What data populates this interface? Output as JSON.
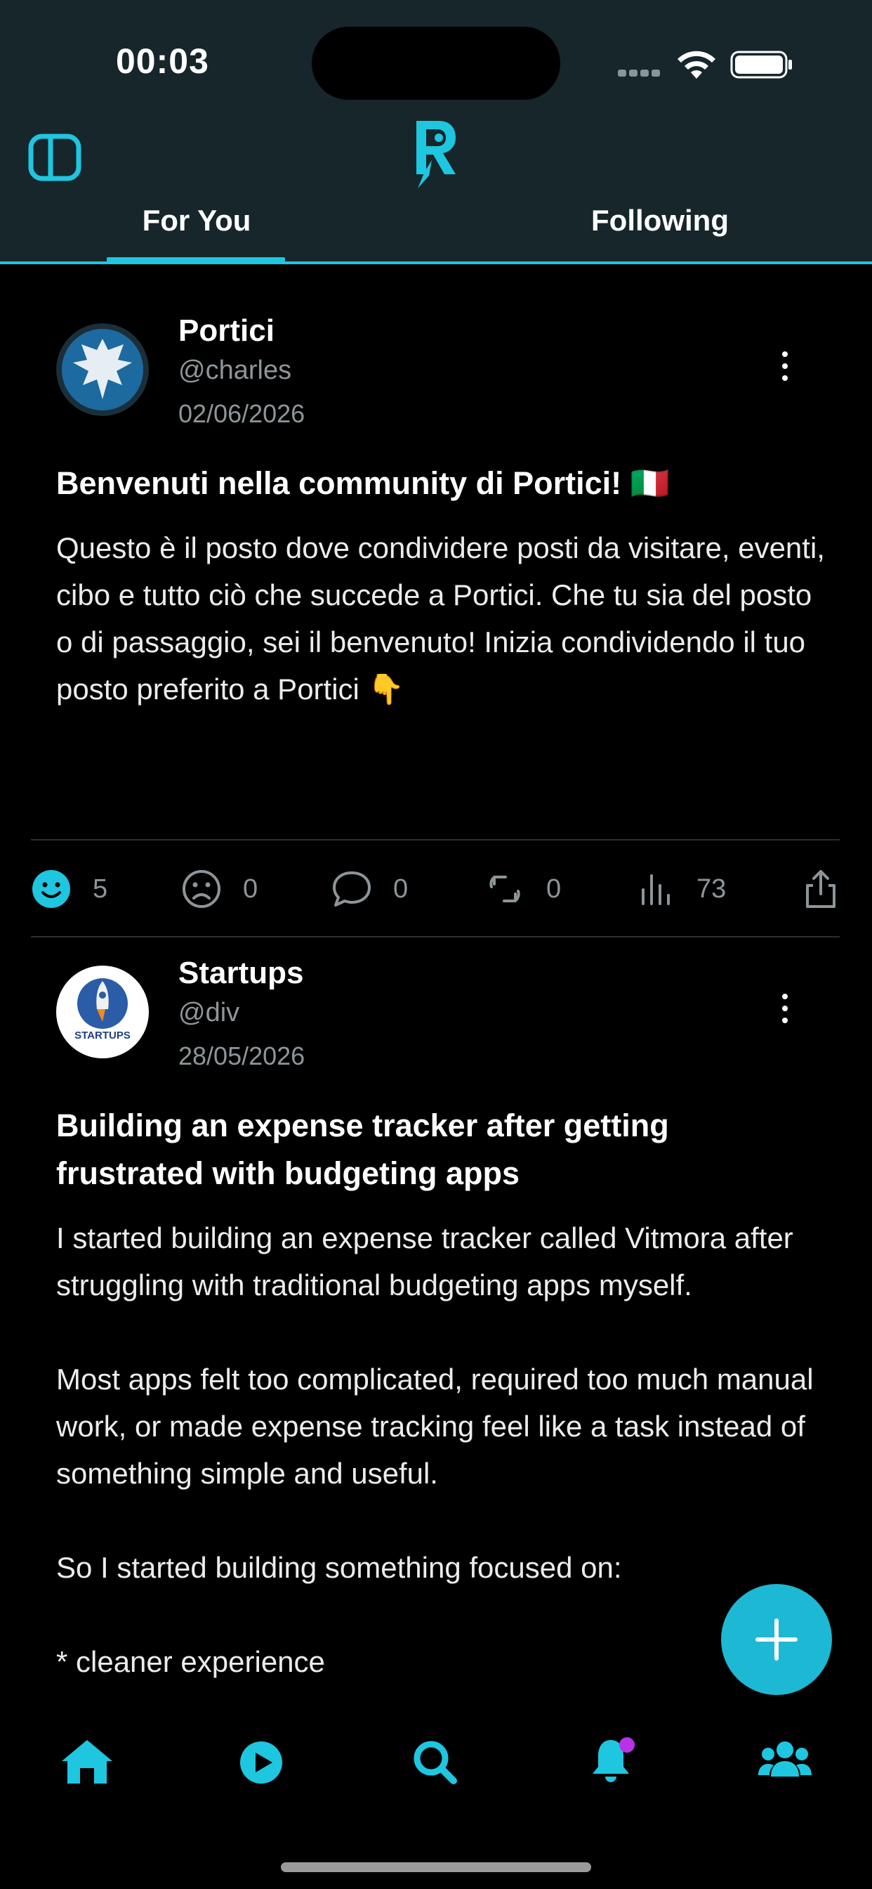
{
  "status_bar": {
    "time": "00:03"
  },
  "header": {
    "tabs": [
      {
        "label": "For You",
        "active": true
      },
      {
        "label": "Following",
        "active": false
      }
    ],
    "accent_color": "#1ec6e0"
  },
  "posts": [
    {
      "author": "Portici",
      "handle": "@charles",
      "date": "02/06/2026",
      "title": "Benvenuti nella community di Portici! 🇮🇹",
      "body": "Questo è il posto dove condividere posti da visitare, eventi, cibo e tutto ciò che succede a Portici. Che tu sia del posto o di passaggio, sei il benvenuto! Inizia condividendo il tuo posto preferito a Portici 👇",
      "stats": {
        "likes": "5",
        "dislikes": "0",
        "comments": "0",
        "reposts": "0",
        "views": "73"
      }
    },
    {
      "author": "Startups",
      "handle": "@div",
      "date": "28/05/2026",
      "title": "Building an expense tracker after getting frustrated with budgeting apps",
      "body": "I started building an expense tracker called Vitmora after struggling with traditional budgeting apps myself.\n\nMost apps felt too complicated, required too much manual work, or made expense tracking feel like a task instead of something simple and useful.\n\nSo I started building something focused on:\n\n* cleaner experience",
      "avatar_text": "STARTUPS"
    }
  ],
  "fab": {
    "icon": "plus-icon"
  },
  "bottom_nav": [
    {
      "icon": "home-icon"
    },
    {
      "icon": "play-icon"
    },
    {
      "icon": "search-icon"
    },
    {
      "icon": "bell-icon",
      "has_badge": true
    },
    {
      "icon": "users-icon"
    }
  ]
}
